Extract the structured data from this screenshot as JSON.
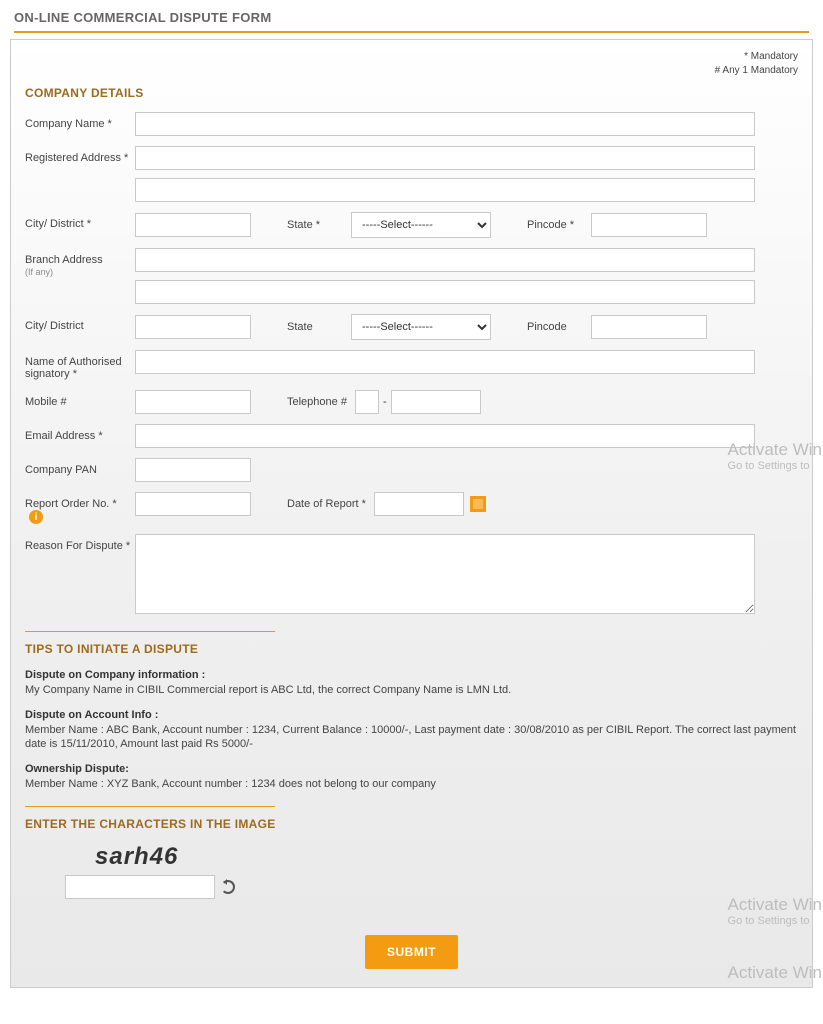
{
  "page": {
    "title": "ON-LINE COMMERCIAL DISPUTE FORM",
    "mandatory_note_1": "* Mandatory",
    "mandatory_note_2": "# Any 1 Mandatory"
  },
  "sections": {
    "company_details": "COMPANY DETAILS",
    "tips_heading": "TIPS TO INITIATE A DISPUTE",
    "captcha_heading": "ENTER THE CHARACTERS IN THE IMAGE"
  },
  "labels": {
    "company_name": "Company Name *",
    "registered_address": "Registered Address *",
    "city_district_1": "City/ District *",
    "state_1": "State *",
    "pincode_1": "Pincode *",
    "branch_address": "Branch Address",
    "branch_sub": "(If any)",
    "city_district_2": "City/ District",
    "state_2": "State",
    "pincode_2": "Pincode",
    "authorised_signatory": "Name of Authorised signatory *",
    "mobile": "Mobile #",
    "telephone": "Telephone #",
    "email": "Email Address *",
    "company_pan": "Company PAN",
    "report_order_no": "Report Order No. *",
    "date_of_report": "Date of Report *",
    "reason_for_dispute": "Reason For Dispute *"
  },
  "selects": {
    "state_default": "-----Select------"
  },
  "tips": {
    "t1_title": "Dispute on Company information :",
    "t1_body": "My Company Name in CIBIL Commercial report is ABC Ltd, the correct Company Name is LMN Ltd.",
    "t2_title": "Dispute on Account Info :",
    "t2_body": "Member Name : ABC Bank, Account number : 1234, Current Balance : 10000/-, Last payment date : 30/08/2010 as per CIBIL Report. The correct last payment date is 15/11/2010, Amount last paid Rs 5000/-",
    "t3_title": "Ownership Dispute:",
    "t3_body": "Member Name : XYZ Bank, Account number : 1234 does not belong to our company"
  },
  "captcha": {
    "value": "sarh46"
  },
  "buttons": {
    "submit": "SUBMIT"
  },
  "watermark": {
    "line1": "Activate Win",
    "line2": "Go to Settings to"
  }
}
